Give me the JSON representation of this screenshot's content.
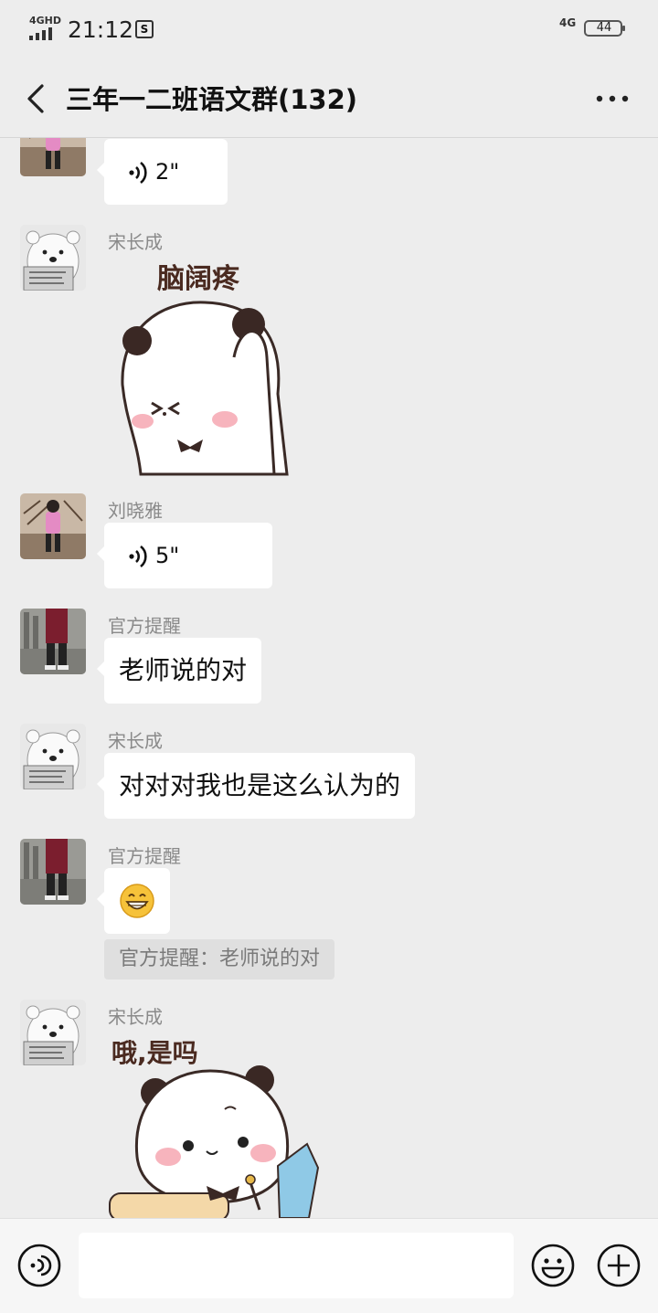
{
  "status_bar": {
    "network_left": "4GHD",
    "time": "21:12",
    "network_right": "4G",
    "battery": "44"
  },
  "header": {
    "title": "三年一二班语文群(132)"
  },
  "messages": [
    {
      "type": "voice",
      "duration": "2\""
    },
    {
      "type": "sticker",
      "sender": "宋长成",
      "sticker_text": "脑阔疼"
    },
    {
      "type": "voice",
      "sender": "刘晓雅",
      "duration": "5\""
    },
    {
      "type": "text",
      "sender": "官方提醒",
      "text": "老师说的对"
    },
    {
      "type": "text",
      "sender": "宋长成",
      "text": "对对对我也是这么认为的"
    },
    {
      "type": "emoji",
      "sender": "官方提醒",
      "emoji": "😁",
      "quote": "官方提醒：老师说的对"
    },
    {
      "type": "sticker",
      "sender": "宋长成",
      "sticker_text": "哦,是吗"
    }
  ],
  "input_bar": {
    "placeholder": ""
  },
  "colors": {
    "background": "#ededed",
    "bubble": "#ffffff",
    "sender_name": "#8a8a8a"
  }
}
